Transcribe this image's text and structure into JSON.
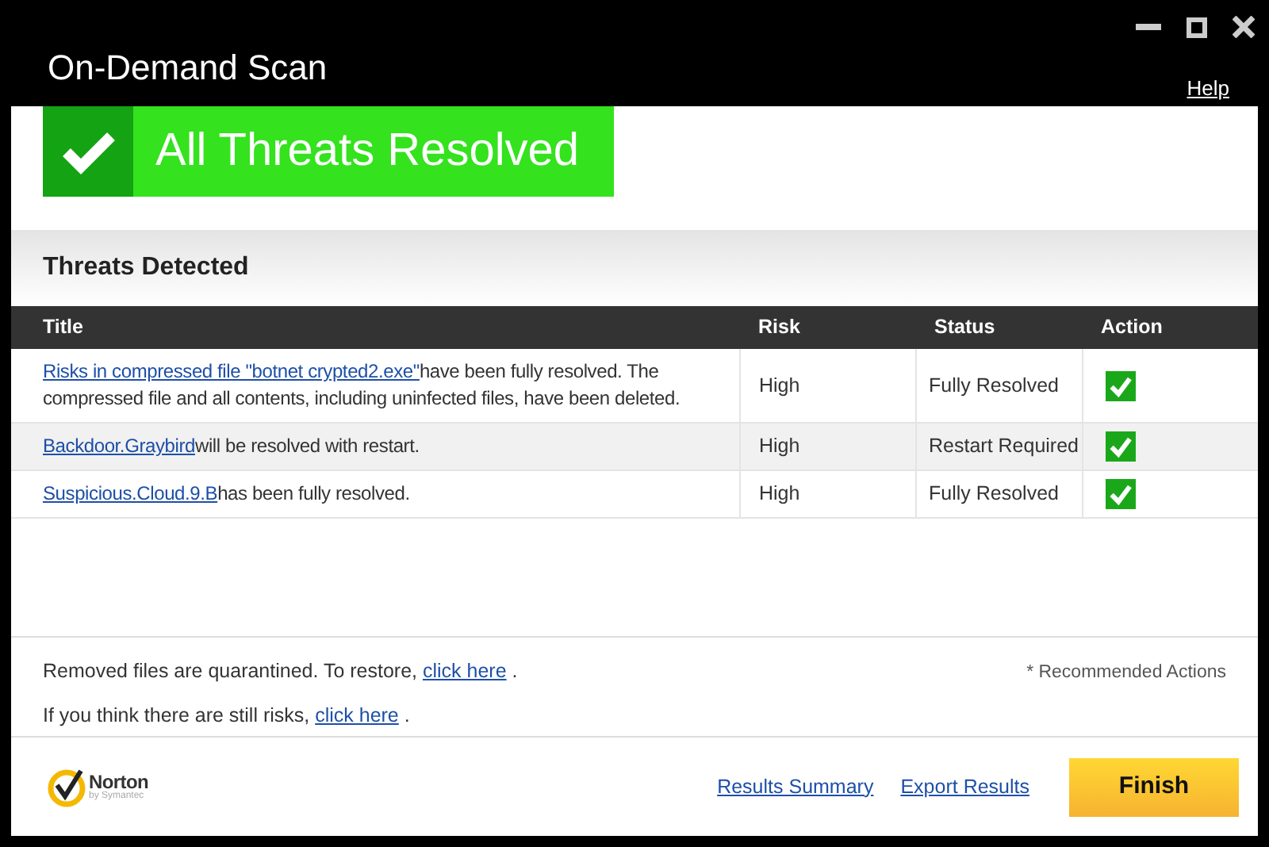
{
  "window": {
    "title": "On-Demand Scan",
    "help": "Help"
  },
  "banner": {
    "text": "All Threats Resolved",
    "resolved": true
  },
  "section": {
    "title": "Threats Detected"
  },
  "table": {
    "columns": [
      "Title",
      "Risk",
      "Status",
      "Action"
    ],
    "rows": [
      {
        "link": "Risks in compressed file \"botnet crypted2.exe\"",
        "text": "have been fully resolved. The compressed file and all contents, including uninfected files, have been deleted.",
        "risk": "High",
        "status": "Fully Resolved",
        "resolved": true
      },
      {
        "link": "Backdoor.Graybird",
        "text": "will be resolved with restart.",
        "risk": "High",
        "status": "Restart Required",
        "resolved": true
      },
      {
        "link": "Suspicious.Cloud.9.B",
        "text": "has been fully resolved.",
        "risk": "High",
        "status": "Fully Resolved",
        "resolved": true
      }
    ]
  },
  "notes": [
    {
      "before": "Removed files are quarantined. To restore,",
      "link": "click here",
      "after": "."
    },
    {
      "before": "If you think there are still risks,",
      "link": "click here",
      "after": "."
    }
  ],
  "recommended_note": "* Recommended Actions",
  "footer": {
    "logo": "Norton",
    "logo_sub": "by Symantec",
    "links": [
      "Results Summary",
      "Export Results"
    ],
    "finish": "Finish"
  }
}
